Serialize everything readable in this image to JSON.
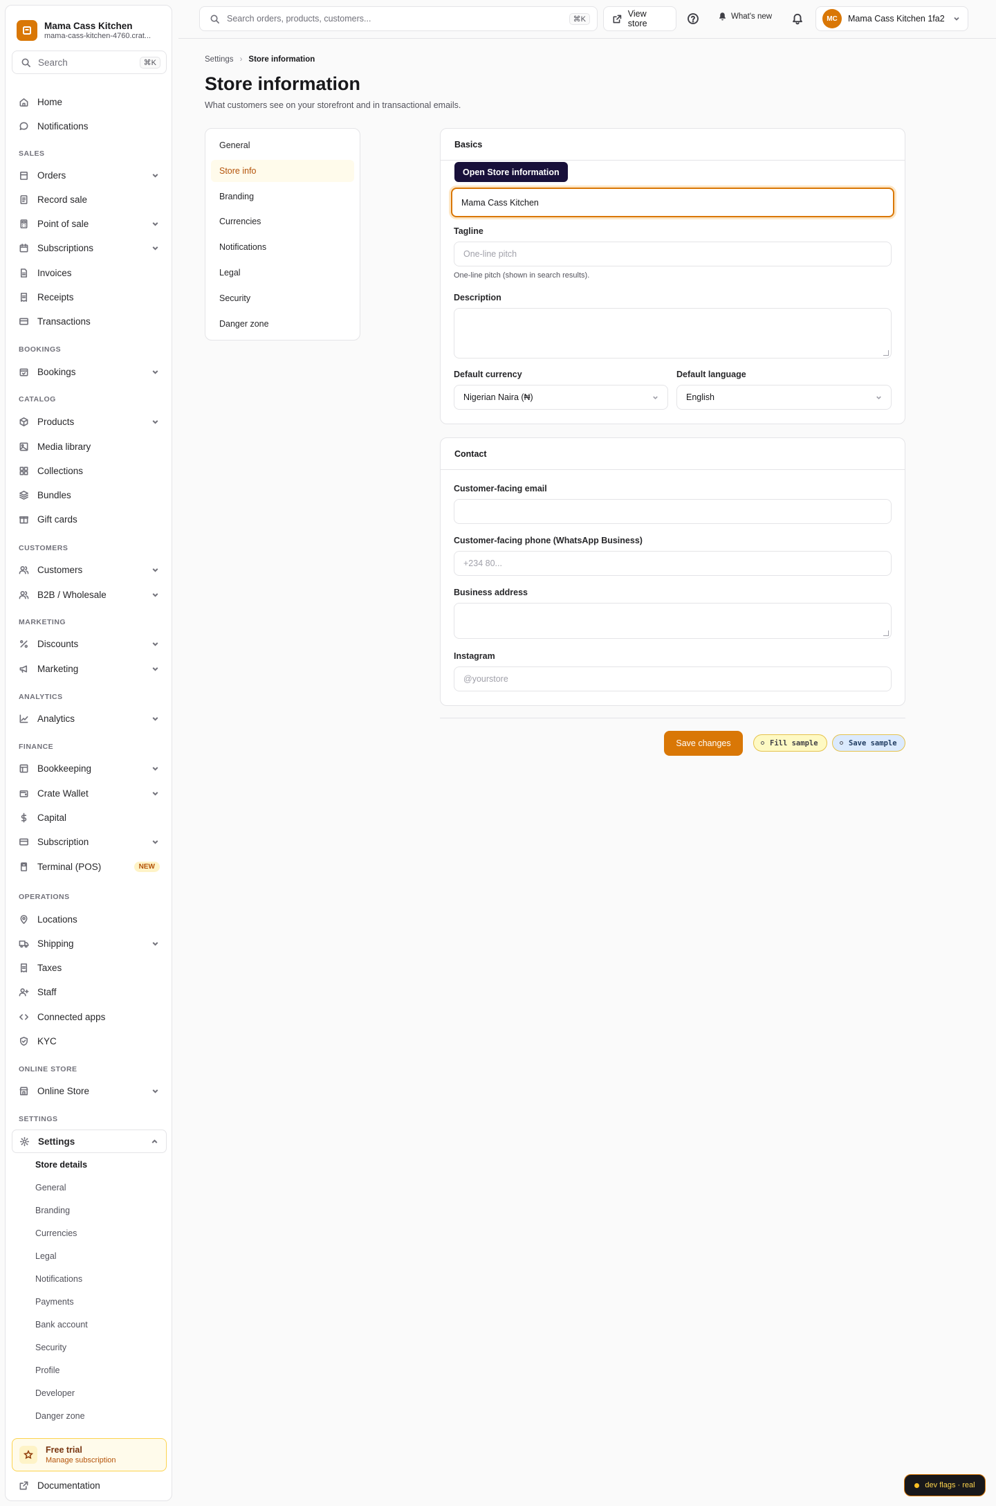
{
  "sidebar": {
    "brand_name": "Mama Cass Kitchen",
    "brand_sub": "mama-cass-kitchen-4760.crat...",
    "search_label": "Search",
    "search_kbd": "⌘K",
    "home": "Home",
    "notifications": "Notifications",
    "sec_sales": "SALES",
    "orders": "Orders",
    "record_sale": "Record sale",
    "point_of_sale": "Point of sale",
    "subscriptions": "Subscriptions",
    "invoices": "Invoices",
    "receipts": "Receipts",
    "transactions": "Transactions",
    "sec_bookings": "BOOKINGS",
    "bookings": "Bookings",
    "sec_catalog": "CATALOG",
    "products": "Products",
    "media_library": "Media library",
    "collections": "Collections",
    "bundles": "Bundles",
    "gift_cards": "Gift cards",
    "sec_customers": "CUSTOMERS",
    "customers": "Customers",
    "b2b": "B2B / Wholesale",
    "sec_marketing": "MARKETING",
    "discounts": "Discounts",
    "marketing": "Marketing",
    "sec_analytics": "ANALYTICS",
    "analytics": "Analytics",
    "sec_finance": "FINANCE",
    "bookkeeping": "Bookkeeping",
    "crate_wallet": "Crate Wallet",
    "capital": "Capital",
    "subscription": "Subscription",
    "terminal": "Terminal (POS)",
    "new_badge": "NEW",
    "sec_operations": "OPERATIONS",
    "locations": "Locations",
    "shipping": "Shipping",
    "taxes": "Taxes",
    "staff": "Staff",
    "connected_apps": "Connected apps",
    "kyc": "KYC",
    "sec_online_store": "ONLINE STORE",
    "online_store": "Online Store",
    "sec_settings": "SETTINGS",
    "settings": "Settings",
    "settings_sub": [
      "Store details",
      "General",
      "Branding",
      "Currencies",
      "Legal",
      "Notifications",
      "Payments",
      "Bank account",
      "Security",
      "Profile",
      "Developer",
      "Danger zone"
    ],
    "trial_title": "Free trial",
    "trial_sub": "Manage subscription",
    "documentation": "Documentation"
  },
  "topbar": {
    "search_placeholder": "Search orders, products, customers...",
    "search_kbd": "⌘K",
    "view_store": "View store",
    "whats_new": "What's new",
    "avatar_initials": "MC",
    "account_name": "Mama Cass Kitchen 1fa2"
  },
  "header": {
    "breadcrumb_root": "Settings",
    "breadcrumb_current": "Store information",
    "title": "Store information",
    "subtitle": "What customers see on your storefront and in transactional emails."
  },
  "tabs": [
    "General",
    "Store info",
    "Branding",
    "Currencies",
    "Notifications",
    "Legal",
    "Security",
    "Danger zone"
  ],
  "basics": {
    "heading": "Basics",
    "tooltip": "Open Store information",
    "store_name_value": "Mama Cass Kitchen",
    "tagline_label": "Tagline",
    "tagline_placeholder": "One-line pitch",
    "tagline_help": "One-line pitch (shown in search results).",
    "description_label": "Description",
    "currency_label": "Default currency",
    "currency_value": "Nigerian Naira (₦)",
    "language_label": "Default language",
    "language_value": "English"
  },
  "contact": {
    "heading": "Contact",
    "email_label": "Customer-facing email",
    "phone_label": "Customer-facing phone (WhatsApp Business)",
    "phone_placeholder": "+234 80...",
    "address_label": "Business address",
    "instagram_label": "Instagram",
    "instagram_placeholder": "@yourstore"
  },
  "actions": {
    "save": "Save changes",
    "fill_sample": "Fill sample",
    "save_sample": "Save sample",
    "dev_flags": "dev flags · real"
  }
}
